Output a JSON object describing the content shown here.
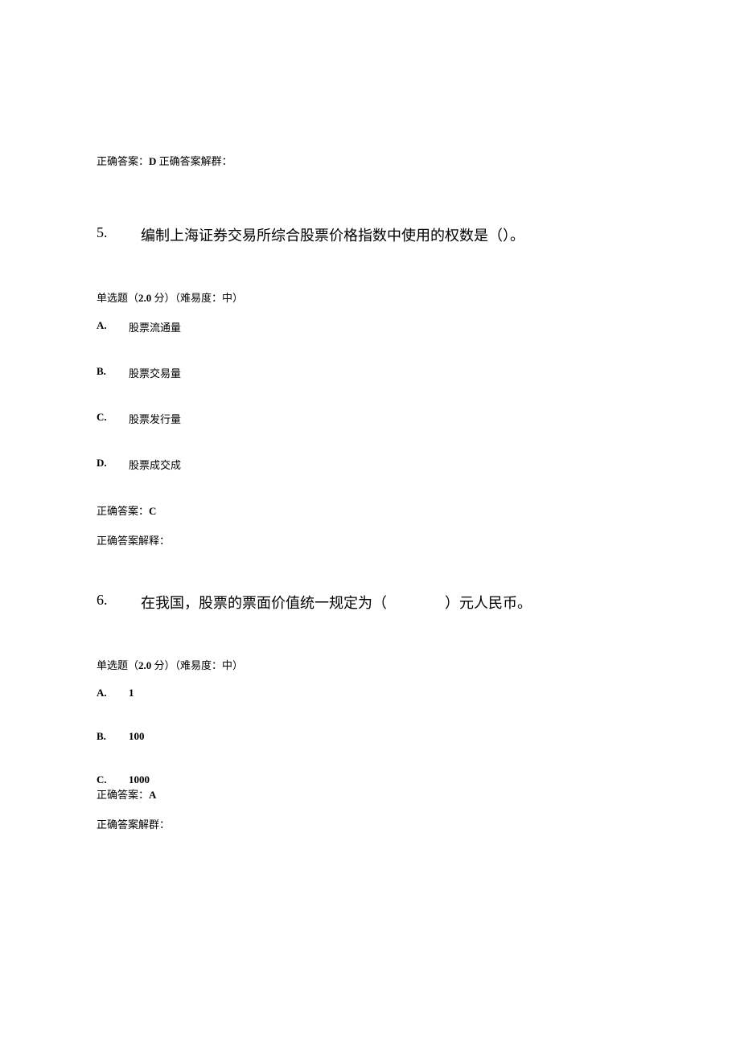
{
  "q4_answer": {
    "prefix": "正确答案：",
    "letter": "D",
    "suffix": " 正确答案解群："
  },
  "q5": {
    "number": "5.",
    "title": "编制上海证券交易所综合股票价格指数中使用的权数是（）。",
    "meta_prefix": "单选题（",
    "meta_points": "2.0",
    "meta_suffix": " 分）（难易度：中）",
    "options": [
      {
        "letter": "A.",
        "text": "股票流通量"
      },
      {
        "letter": "B.",
        "text": "股票交易量"
      },
      {
        "letter": "C.",
        "text": "股票发行量"
      },
      {
        "letter": "D.",
        "text": "股票成交成"
      }
    ],
    "answer_prefix": "正确答案：",
    "answer_letter": "C",
    "explanation": "正确答案解释："
  },
  "q6": {
    "number": "6.",
    "title": "在我国，股票的票面价值统一规定为（　　　　）元人民币。",
    "meta_prefix": "单选题（",
    "meta_points": "2.0",
    "meta_suffix": " 分）（难易度：中）",
    "options": [
      {
        "letter": "A.",
        "text": "1"
      },
      {
        "letter": "B.",
        "text": "100"
      },
      {
        "letter": "C.",
        "text": "1000"
      }
    ],
    "answer_prefix": "正确答案：",
    "answer_letter": "A",
    "explanation": "正确答案解群："
  }
}
